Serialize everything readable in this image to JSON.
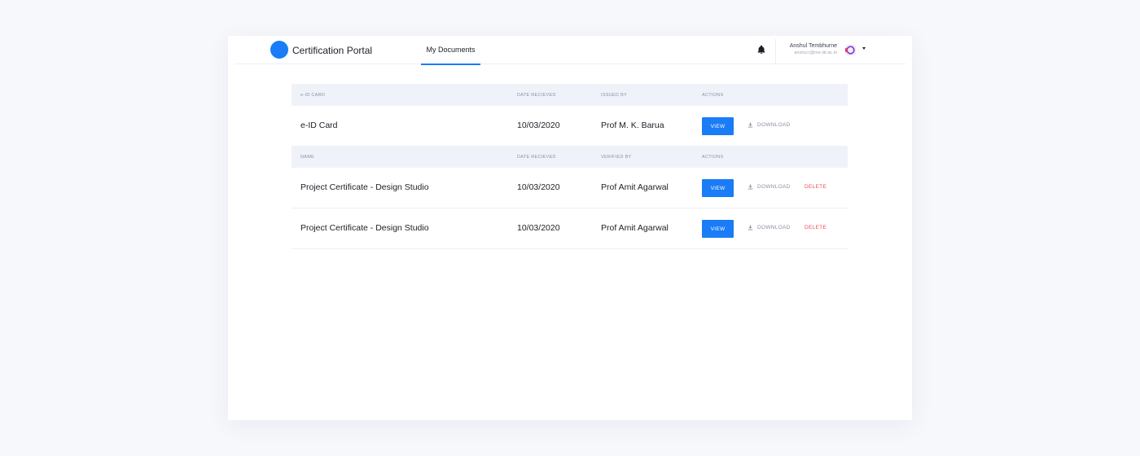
{
  "header": {
    "app_title": "Certification Portal",
    "nav_tab": "My Documents",
    "user": {
      "name": "Anshul Tembhurne",
      "email": "anshul.t@me.iitr.ac.in"
    }
  },
  "icons": {
    "logo": "logo-circle",
    "notifications": "bell-icon",
    "avatar": "user-avatar",
    "menu": "chevron-down-icon",
    "download": "download-icon"
  },
  "colors": {
    "accent": "#1a7cf6",
    "danger": "#ef4f5e",
    "header_bg": "#eff2f9",
    "muted": "#8a90a2"
  },
  "eid_section": {
    "headers": [
      "e-ID CARD",
      "DATE RECIEVED",
      "ISSUED BY",
      "ACTIONS"
    ],
    "rows": [
      {
        "name": "e-ID Card",
        "date": "10/03/2020",
        "person": "Prof M. K. Barua",
        "view_label": "VIEW",
        "download_label": "DOWNLOAD"
      }
    ]
  },
  "docs_section": {
    "headers": [
      "NAME",
      "DATE RECIEVED",
      "VERIFIED BY",
      "ACTIONS"
    ],
    "rows": [
      {
        "name": "Project Certificate - Design Studio",
        "date": "10/03/2020",
        "person": "Prof Amit Agarwal",
        "view_label": "VIEW",
        "download_label": "DOWNLOAD",
        "delete_label": "DELETE"
      },
      {
        "name": "Project Certificate - Design Studio",
        "date": "10/03/2020",
        "person": "Prof Amit Agarwal",
        "view_label": "VIEW",
        "download_label": "DOWNLOAD",
        "delete_label": "DELETE"
      }
    ]
  }
}
